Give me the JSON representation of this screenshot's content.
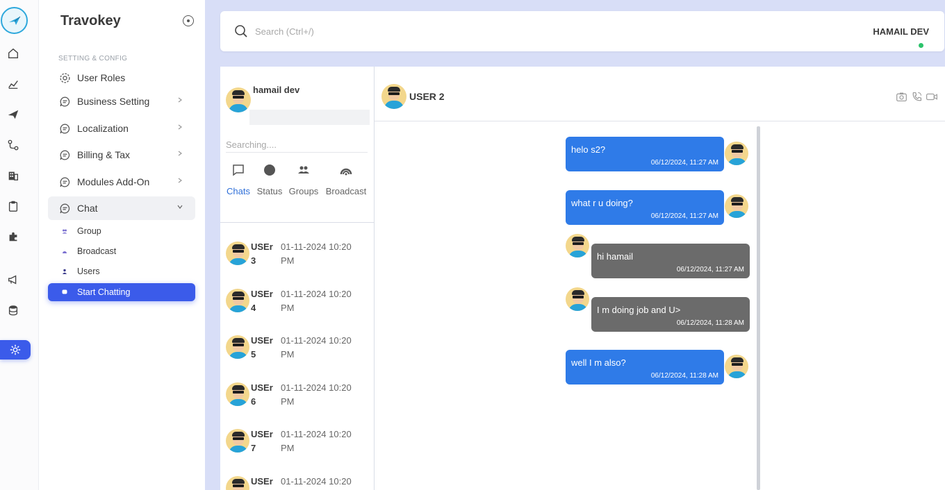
{
  "app": {
    "brand": "Travokey"
  },
  "rail": {
    "icons": [
      "home-icon",
      "chart-icon",
      "plane-icon",
      "route-icon",
      "building-icon",
      "clipboard-icon",
      "puzzle-icon",
      "megaphone-icon",
      "database-icon",
      "gear-icon"
    ],
    "active": "gear-icon"
  },
  "sidebar": {
    "section_title": "SETTING & CONFIG",
    "items": [
      {
        "label": "User Roles",
        "icon": "gear-icon"
      },
      {
        "label": "Business Setting",
        "icon": "chat-bubble-icon"
      },
      {
        "label": "Localization",
        "icon": "chat-bubble-icon"
      },
      {
        "label": "Billing & Tax",
        "icon": "chat-bubble-icon"
      },
      {
        "label": "Modules Add-On",
        "icon": "chat-bubble-icon"
      },
      {
        "label": "Chat",
        "icon": "chat-bubble-icon"
      }
    ],
    "chat_sub": [
      {
        "label": "Group"
      },
      {
        "label": "Broadcast"
      },
      {
        "label": "Users"
      },
      {
        "label": "Start Chatting"
      }
    ]
  },
  "topbar": {
    "search_placeholder": "Search (Ctrl+/)",
    "user_name": "HAMAIL DEV"
  },
  "chat_list": {
    "me_name": "hamail dev",
    "search_placeholder": "Searching....",
    "tabs": [
      {
        "label": "Chats"
      },
      {
        "label": "Status"
      },
      {
        "label": "Groups"
      },
      {
        "label": "Broadcast"
      }
    ],
    "active_tab": "Chats",
    "contacts": [
      {
        "name": "USEr 3",
        "time": "01-11-2024 10:20 PM"
      },
      {
        "name": "USEr 4",
        "time": "01-11-2024 10:20 PM"
      },
      {
        "name": "USEr 5",
        "time": "01-11-2024 10:20 PM"
      },
      {
        "name": "USEr 6",
        "time": "01-11-2024 10:20 PM"
      },
      {
        "name": "USEr 7",
        "time": "01-11-2024 10:20 PM"
      },
      {
        "name": "USEr",
        "time": "01-11-2024 10:20"
      }
    ]
  },
  "conversation": {
    "title": "USER 2",
    "messages": [
      {
        "dir": "out",
        "text": "helo s2?",
        "time": "06/12/2024, 11:27 AM"
      },
      {
        "dir": "out",
        "text": "what r u doing?",
        "time": "06/12/2024, 11:27 AM"
      },
      {
        "dir": "in",
        "text": "hi hamail",
        "time": "06/12/2024, 11:27 AM"
      },
      {
        "dir": "in",
        "text": "I m doing job and U>",
        "time": "06/12/2024, 11:28 AM"
      },
      {
        "dir": "out",
        "text": "well I m also?",
        "time": "06/12/2024, 11:28 AM"
      }
    ]
  },
  "colors": {
    "accent": "#3b5bea",
    "outgoing_bubble": "#2f7be8",
    "incoming_bubble": "#6b6b6b",
    "online": "#2cc36b"
  }
}
